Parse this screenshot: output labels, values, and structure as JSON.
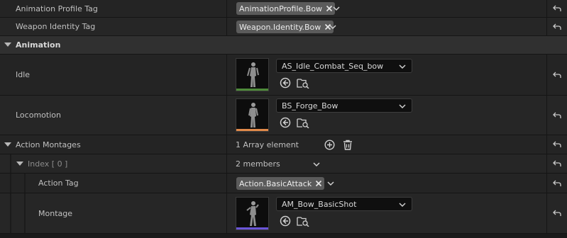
{
  "rows": {
    "animation_profile_tag": {
      "label": "Animation Profile Tag",
      "tag": "AnimationProfile.Bow"
    },
    "weapon_identity_tag": {
      "label": "Weapon Identity Tag",
      "tag": "Weapon.Identity.Bow"
    },
    "animation_category": {
      "label": "Animation"
    },
    "idle": {
      "label": "Idle",
      "asset": "AS_Idle_Combat_Seq_bow",
      "thumb_bar_color": "#4e8a3a"
    },
    "locomotion": {
      "label": "Locomotion",
      "asset": "BS_Forge_Bow",
      "thumb_bar_color": "#e08a4a"
    },
    "action_montages": {
      "label": "Action Montages",
      "value": "1 Array element"
    },
    "index0": {
      "label": "Index [ 0 ]",
      "value": "2 members"
    },
    "action_tag": {
      "label": "Action Tag",
      "tag": "Action.BasicAttack"
    },
    "montage": {
      "label": "Montage",
      "asset": "AM_Bow_BasicShot",
      "thumb_bar_color": "#6a55d8"
    }
  },
  "icons": {
    "reset": "reset-to-default-icon",
    "browse": "browse-to-asset-icon",
    "use_selected": "use-selected-asset-icon",
    "add": "add-element-icon",
    "delete": "delete-all-icon"
  }
}
